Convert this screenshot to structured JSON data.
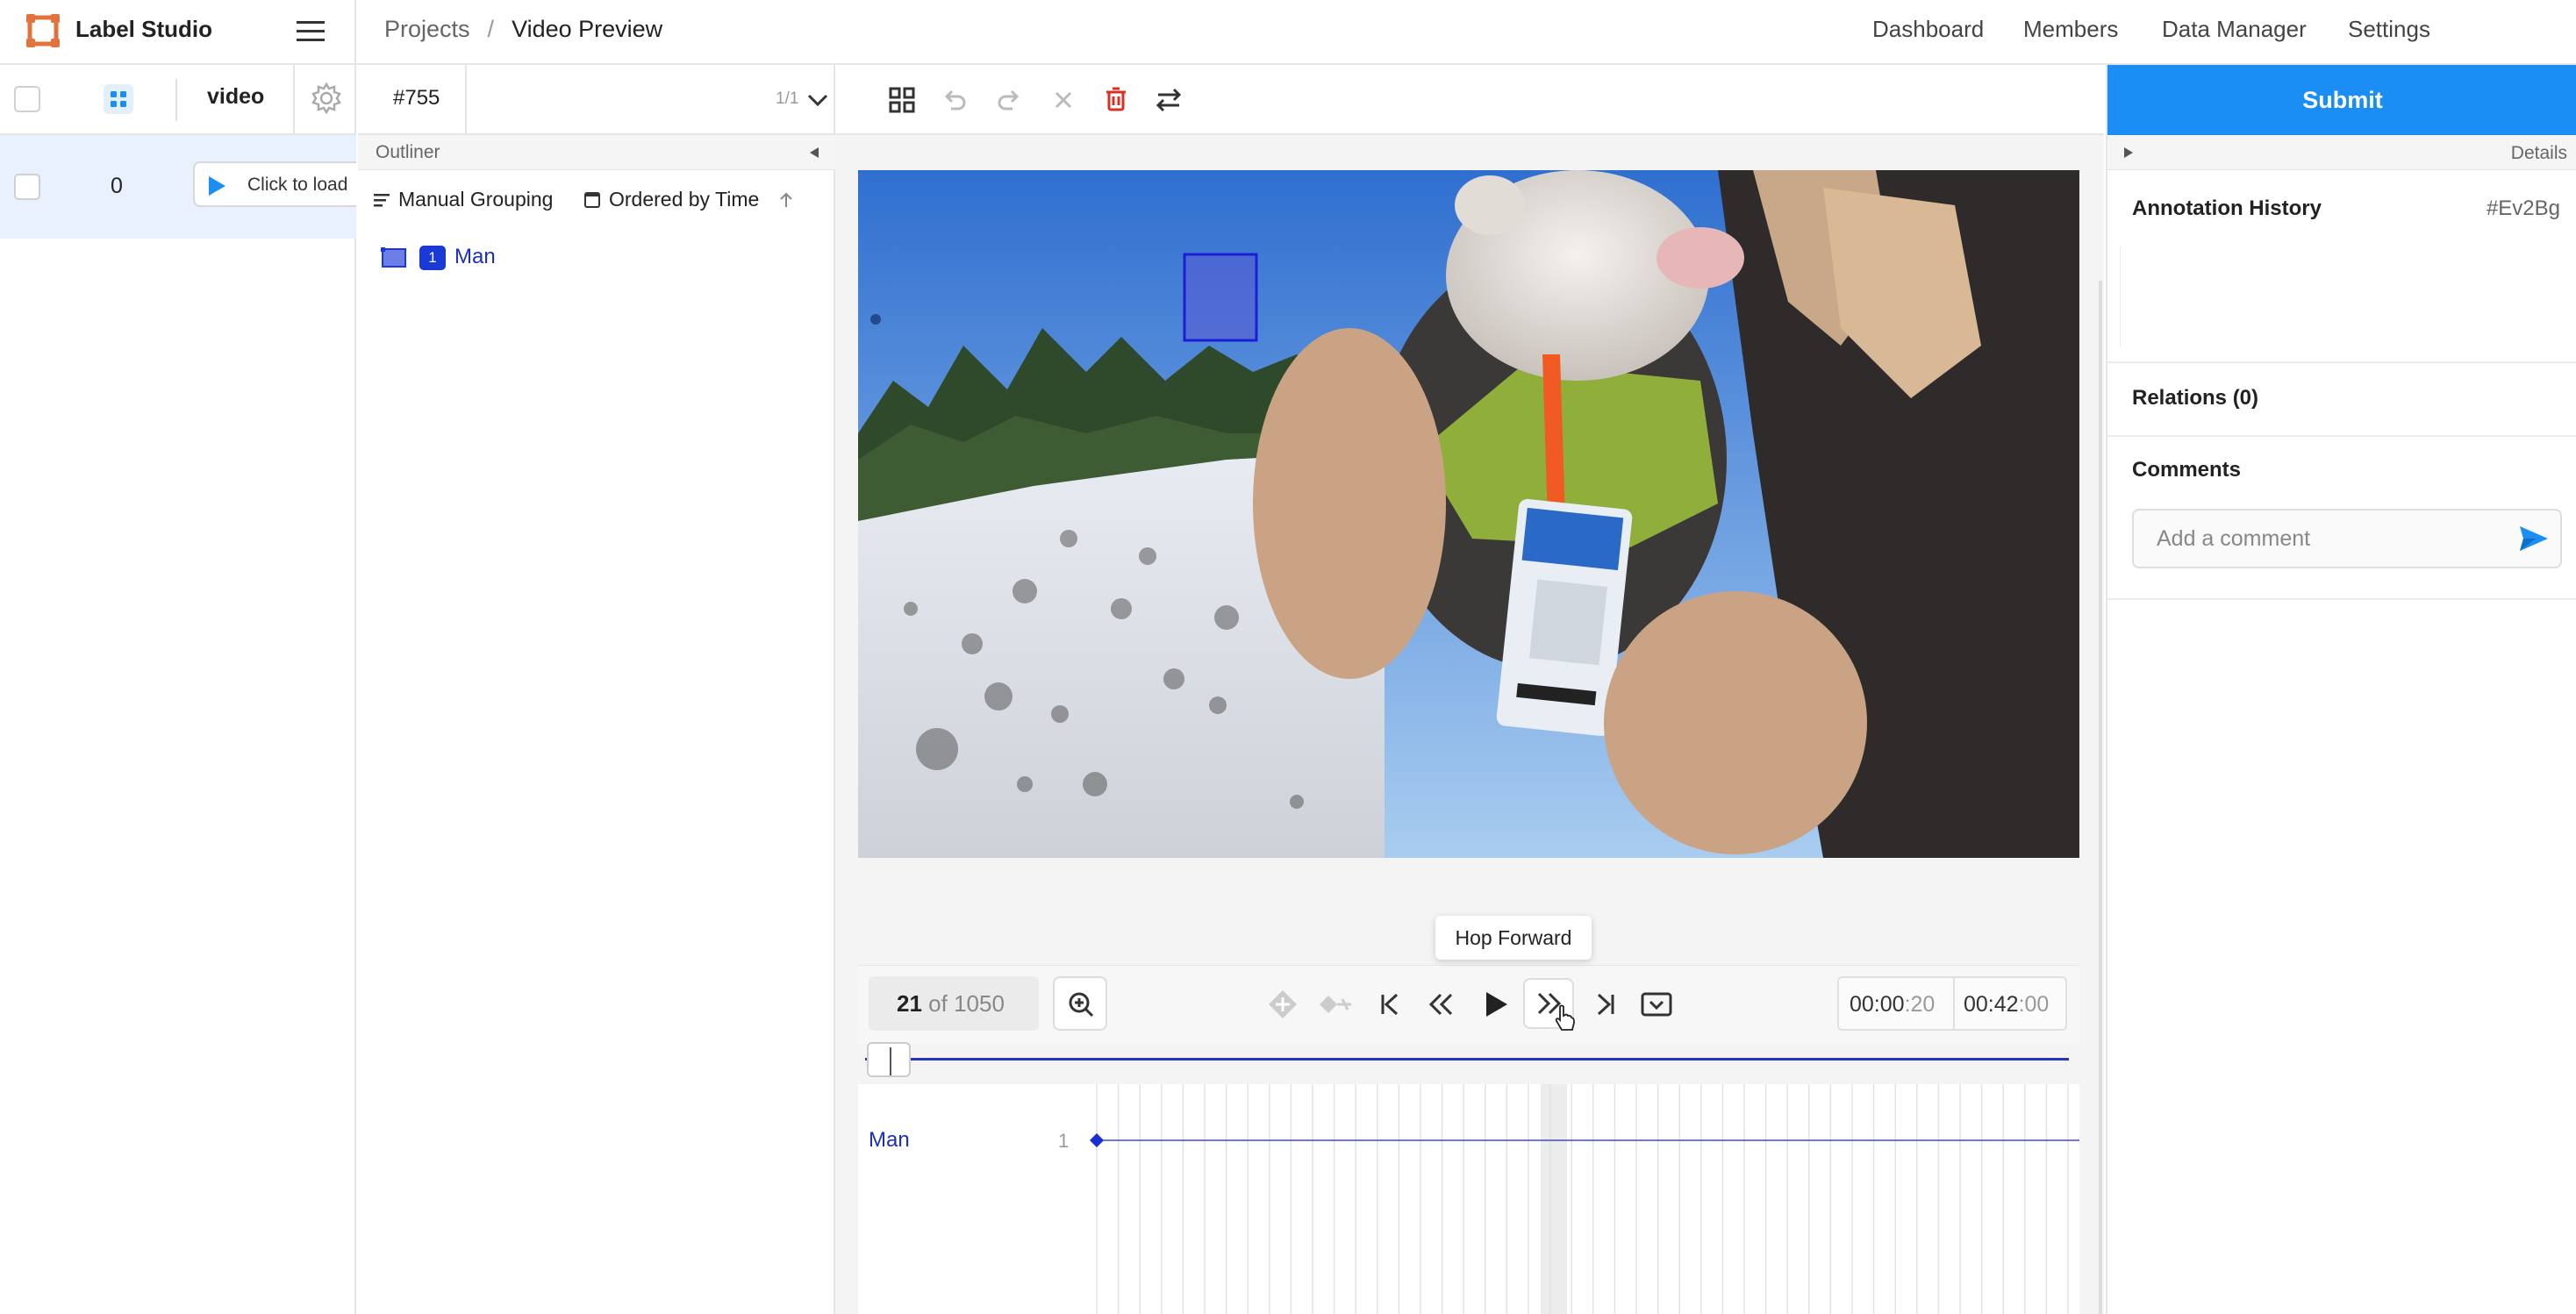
{
  "app": {
    "title": "Label Studio",
    "breadcrumb": [
      "Projects",
      "Video Preview"
    ],
    "breadcrumb_separator": "/",
    "nav": [
      "Dashboard",
      "Members",
      "Data Manager",
      "Settings"
    ]
  },
  "data_manager": {
    "column_video": "video",
    "rows": [
      {
        "id": "0",
        "load_label": "Click to load"
      }
    ]
  },
  "task": {
    "id": "#755",
    "count": "1/1"
  },
  "outliner": {
    "title": "Outliner",
    "group_label": "Manual Grouping",
    "order_label": "Ordered by Time",
    "regions": [
      {
        "index": "1",
        "label": "Man"
      }
    ]
  },
  "toolbar": {
    "icons": [
      "grid-icon",
      "undo-icon",
      "redo-icon",
      "reset-icon",
      "delete-icon",
      "swap-icon"
    ]
  },
  "annotation": {
    "submit_label": "Submit",
    "details_label": "Details",
    "history_label": "Annotation History",
    "annotation_id": "#Ev2Bg",
    "relations_label": "Relations (0)",
    "comments_label": "Comments",
    "comment_placeholder": "Add a comment"
  },
  "player": {
    "frame_current": "21",
    "frame_of": "of 1050",
    "time_current_main": "00:00",
    "time_current_frac": ":20",
    "time_total_main": "00:42",
    "time_total_frac": ":00",
    "tooltip": "Hop Forward",
    "progress_fraction": 0.02
  },
  "timeline": {
    "tracks": [
      {
        "label": "Man",
        "index": "1"
      }
    ]
  },
  "colors": {
    "accent": "#1a8ef5",
    "region": "#1a3ad6",
    "seek": "#2437b8"
  }
}
